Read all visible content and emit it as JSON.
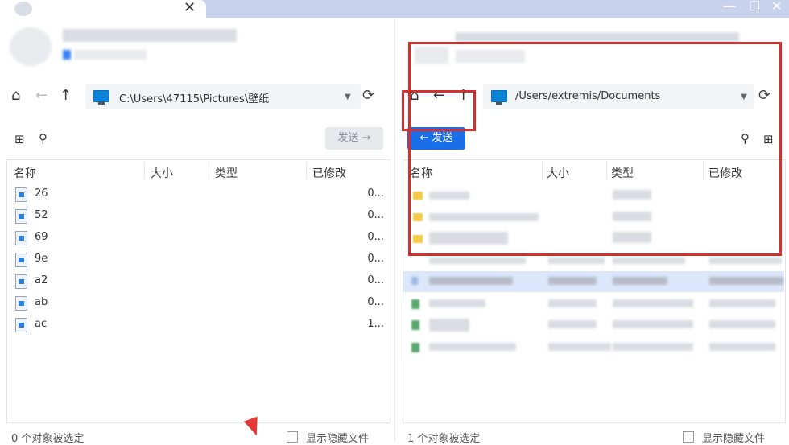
{
  "window": {
    "tab_close": "✕",
    "minimize": "—",
    "maximize": "☐",
    "close": "✕"
  },
  "left": {
    "path": "C:\\Users\\47115\\Pictures\\壁纸",
    "send_label": "发送 →",
    "columns": [
      "名称",
      "大小",
      "类型",
      "已修改"
    ],
    "files": [
      {
        "name": "26",
        "modified": "0..."
      },
      {
        "name": "52",
        "modified": "0..."
      },
      {
        "name": "69",
        "modified": "0..."
      },
      {
        "name": "9e",
        "modified": "0..."
      },
      {
        "name": "a2",
        "modified": "0..."
      },
      {
        "name": "ab",
        "modified": "0..."
      },
      {
        "name": "ac",
        "modified": "1..."
      }
    ],
    "status": "0 个对象被选定",
    "show_hidden": "显示隐藏文件"
  },
  "right": {
    "path": "/Users/extremis/Documents",
    "send_label": "← 发送",
    "columns": [
      "名称",
      "大小",
      "类型",
      "已修改"
    ],
    "status": "1 个对象被选定",
    "show_hidden": "显示隐藏文件"
  },
  "icons": {
    "home": "⌂",
    "back": "←",
    "up": "↑",
    "refresh": "⟳",
    "dropdown": "▼",
    "search": "⚲",
    "new_folder": "⊞"
  },
  "colors": {
    "accent": "#1a6fe8",
    "annotation": "#d32f2f",
    "selection": "#dce7fb"
  }
}
